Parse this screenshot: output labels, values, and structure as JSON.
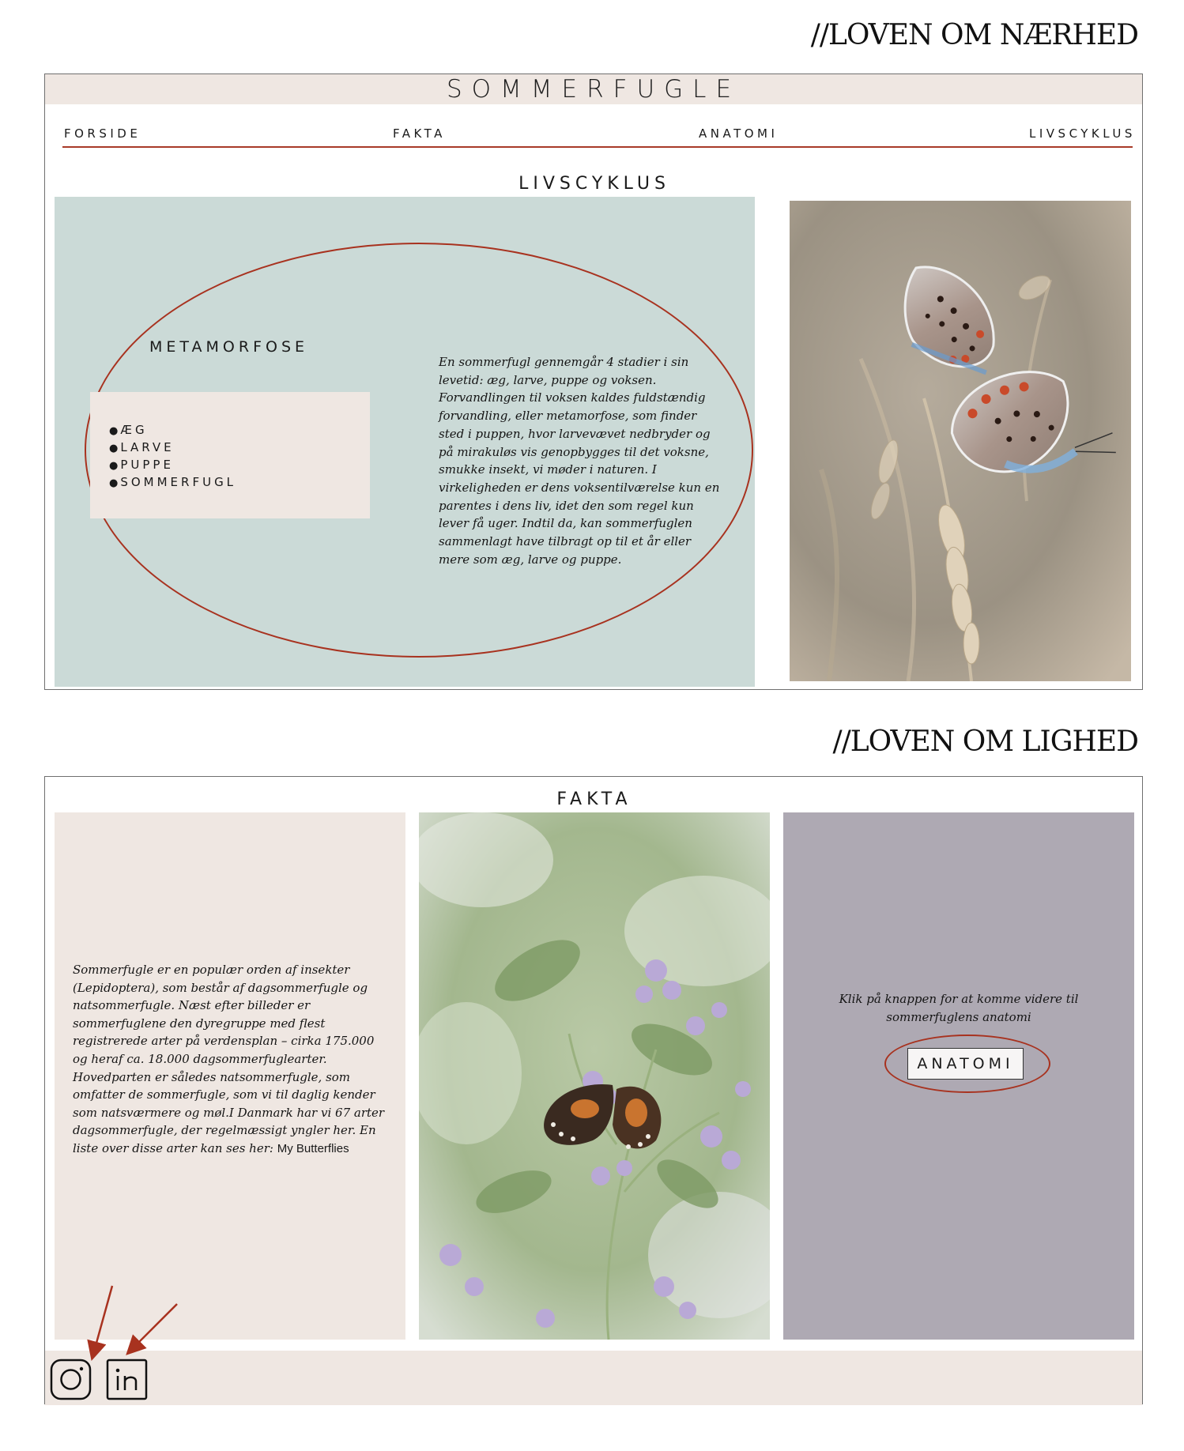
{
  "annotations": {
    "heading_1": "//LOVEN OM NÆRHED",
    "heading_2": "//LOVEN OM LIGHED"
  },
  "site": {
    "title": "SOMMERFUGLE"
  },
  "nav": {
    "items": [
      {
        "label": "FORSIDE"
      },
      {
        "label": "FAKTA"
      },
      {
        "label": "ANATOMI"
      },
      {
        "label": "LIVSCYKLUS"
      }
    ]
  },
  "livscyklus": {
    "title": "LIVSCYKLUS",
    "metamorfose_title": "METAMORFOSE",
    "stages": [
      "ÆG",
      "LARVE",
      "PUPPE",
      "SOMMERFUGL"
    ],
    "body": "En sommerfugl gennemgår 4 stadier i sin levetid: æg, larve, puppe og voksen. Forvandlingen til voksen kaldes fuldstændig forvandling, eller metamorfose, som finder sted i puppen, hvor larvevævet nedbryder og på mirakuløs vis genopbygges til det voksne, smukke insekt, vi møder i naturen. I virkeligheden er dens voksentilværelse kun en parentes i dens liv, idet den som regel kun lever få uger. Indtil da, kan sommerfuglen sammenlagt have tilbragt op til et år eller mere som æg, larve og puppe."
  },
  "fakta": {
    "title": "FAKTA",
    "body": "Sommerfugle er en populær orden af insekter (Lepidoptera), som består af dagsommerfugle og natsommerfugle. Næst efter billeder er sommerfuglene den dyregruppe med flest registrerede arter på verdensplan – cirka 175.000 og heraf ca. 18.000 dagsommerfuglearter. Hovedparten er således natsommerfugle, som omfatter de sommerfugle, som vi til daglig kender som natsværmere og møl.I Danmark har vi 67 arter dagsommerfugle, der regelmæssigt yngler her. En liste over disse arter kan ses her: ",
    "link_label": "My Butterflies",
    "cta_text": "Klik på knappen for at komme videre til sommerfuglens anatomi",
    "button_label": "ANATOMI"
  },
  "footer": {
    "icons": [
      "instagram-icon",
      "linkedin-icon"
    ]
  },
  "colors": {
    "accent_red": "#a8321f",
    "beige": "#efe7e2",
    "mint": "#cbdad7",
    "lavender_grey": "#aea9b3"
  }
}
